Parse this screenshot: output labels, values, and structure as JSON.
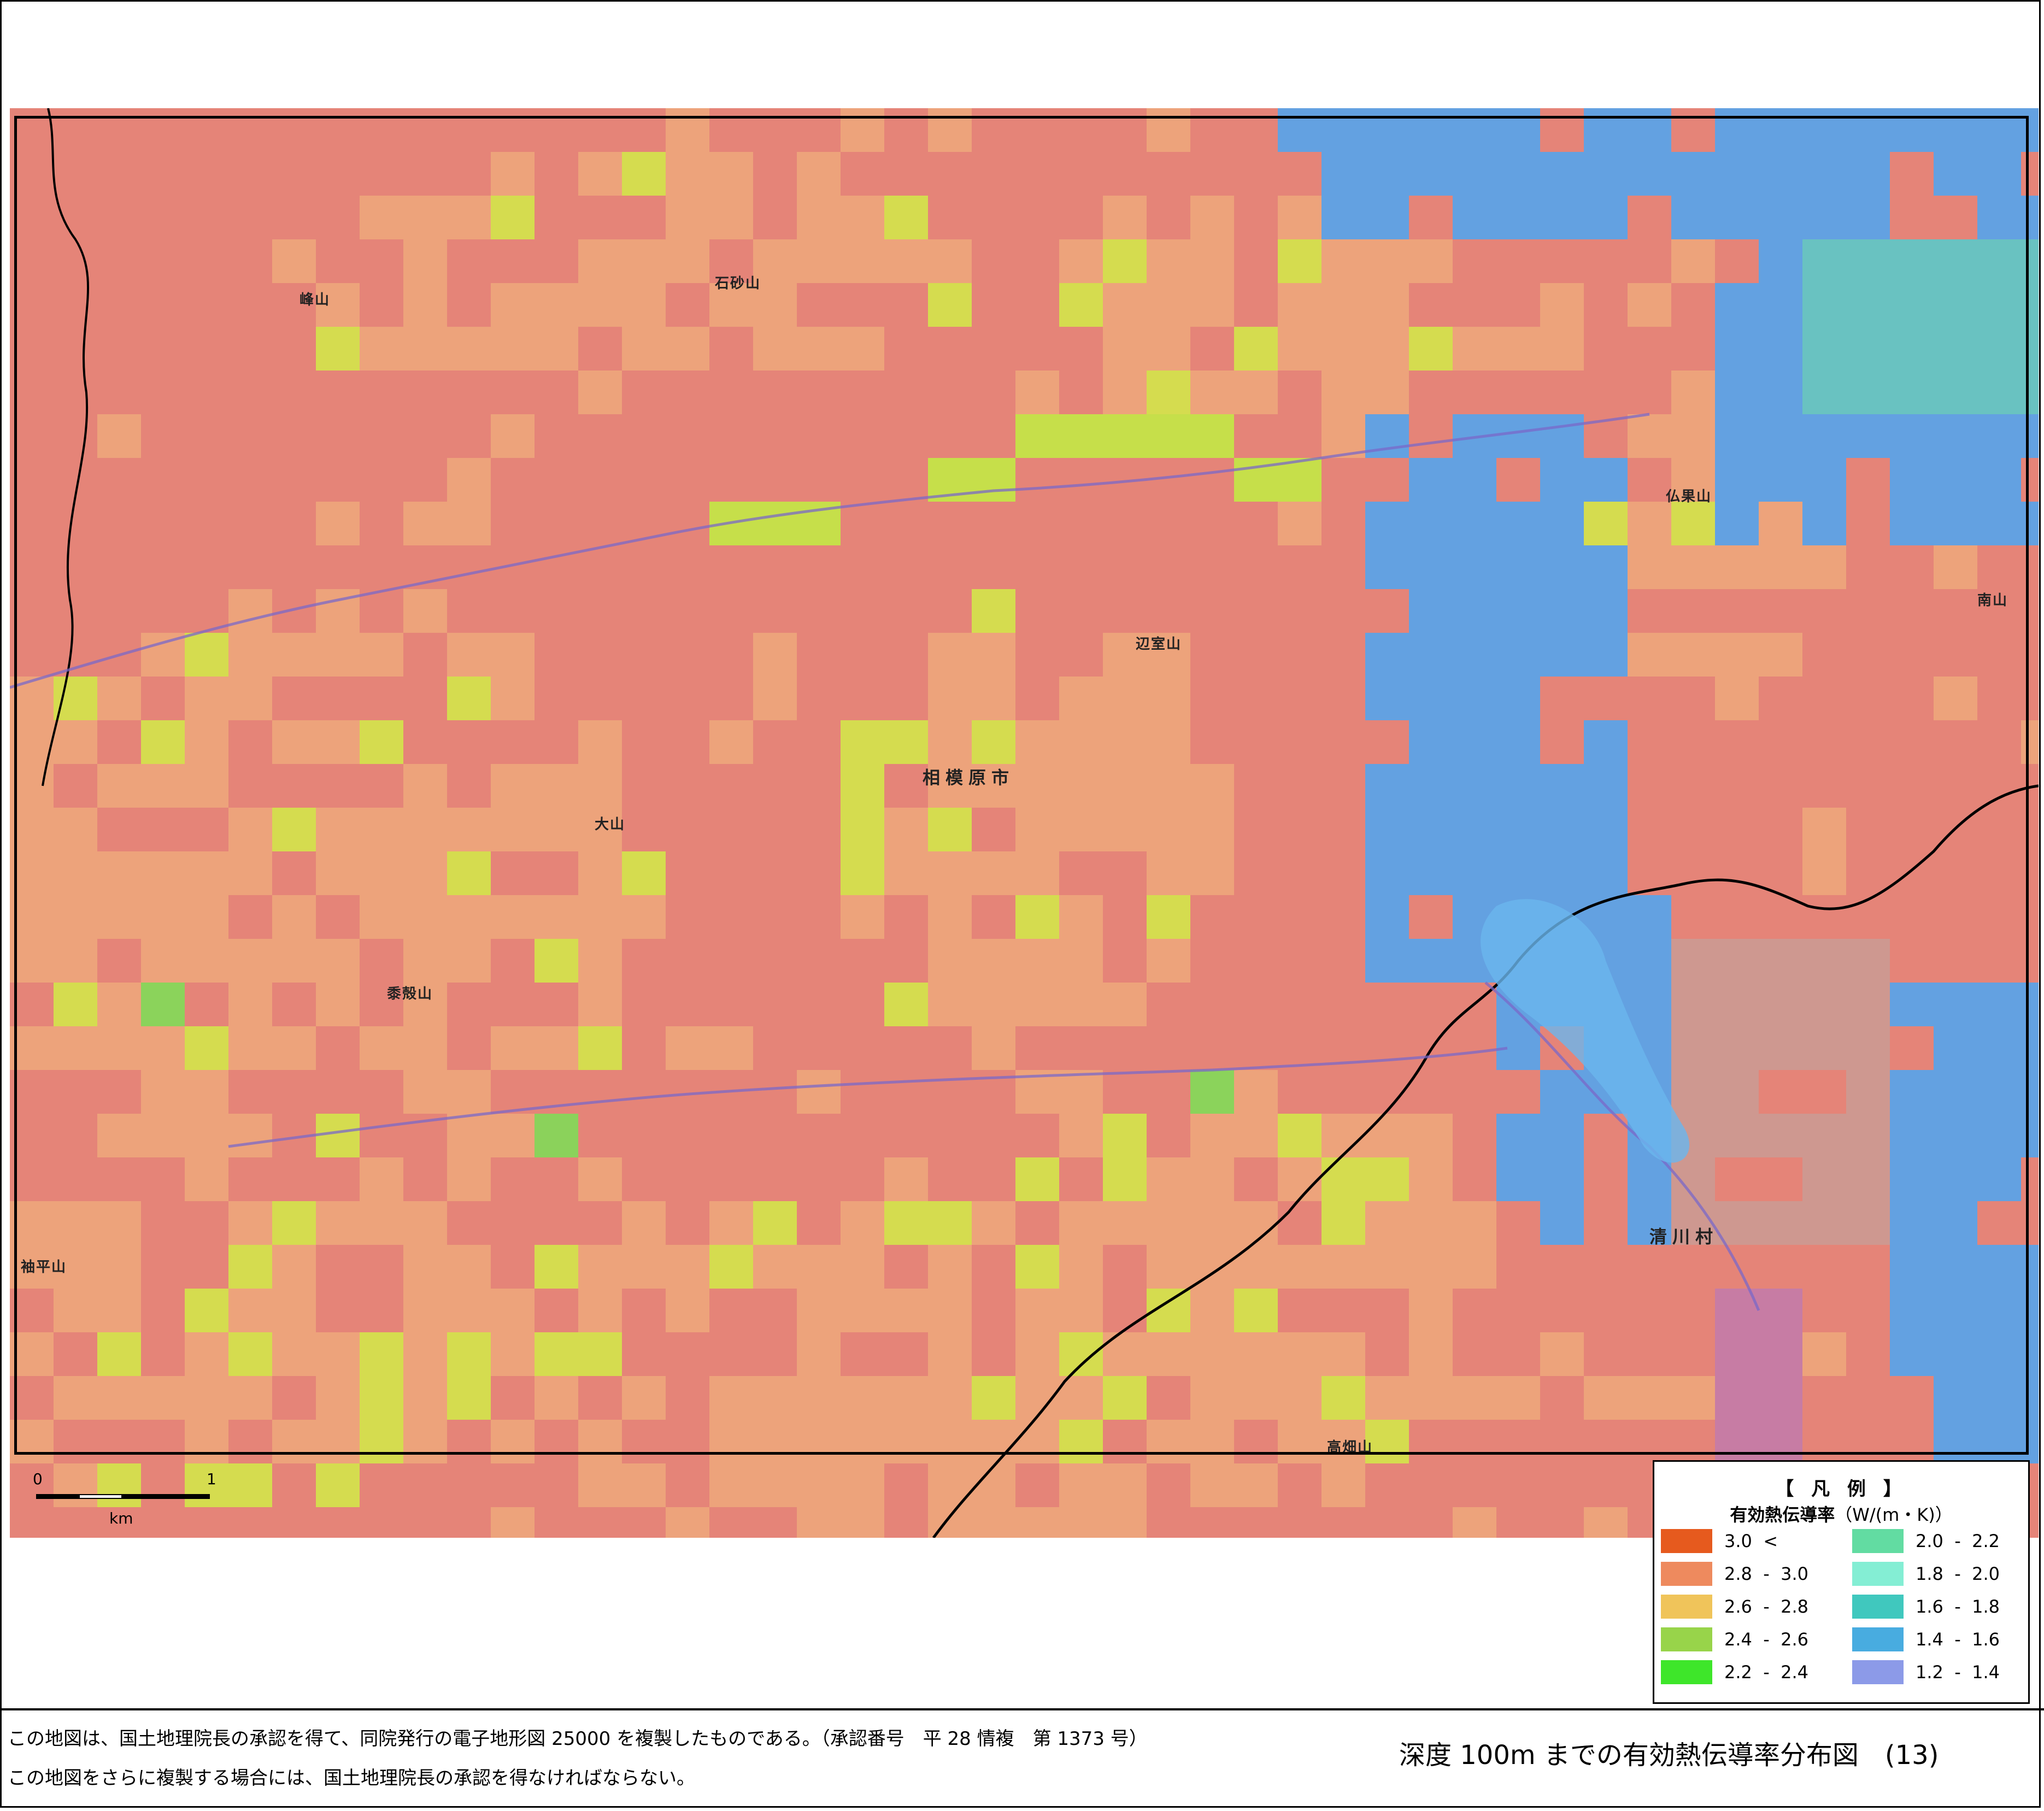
{
  "map": {
    "place_labels": [
      {
        "text": "相模原市",
        "size": "big"
      },
      {
        "text": "清川村",
        "size": "big"
      },
      {
        "text": "石砂山"
      },
      {
        "text": "峰山"
      },
      {
        "text": "仏果山"
      },
      {
        "text": "大山"
      },
      {
        "text": "袖平山"
      },
      {
        "text": "高畑山"
      },
      {
        "text": "南山"
      },
      {
        "text": "黍殻山"
      },
      {
        "text": "辺室山"
      }
    ]
  },
  "scale_bar": {
    "start_label": "0",
    "end_label": "1",
    "unit": "km"
  },
  "legend": {
    "title": "【 凡 例 】",
    "subtitle": "有効熱伝導率",
    "unit": "（W/(m・K)）",
    "items": [
      {
        "label": "3.0  <",
        "color": "#e65a1e"
      },
      {
        "label": "2.8  -  3.0",
        "color": "#ee8a5e"
      },
      {
        "label": "2.6  -  2.8",
        "color": "#f0c45a"
      },
      {
        "label": "2.4  -  2.6",
        "color": "#98d44a"
      },
      {
        "label": "2.2  -  2.4",
        "color": "#3ee62a"
      },
      {
        "label": "2.0  -  2.2",
        "color": "#62dca2"
      },
      {
        "label": "1.8  -  2.0",
        "color": "#84eed4"
      },
      {
        "label": "1.6  -  1.8",
        "color": "#40c8be"
      },
      {
        "label": "1.4  -  1.6",
        "color": "#48ace0"
      },
      {
        "label": "1.2  -  1.4",
        "color": "#8c9ae8"
      }
    ]
  },
  "map_cell_colors": {
    "base": "#e58478",
    "orange": "#eea67c",
    "yellow": "#d4e44c",
    "yellow_green": "#c4e448",
    "green": "#86d65a",
    "blue": "#58a4ea",
    "teal": "#5ec8c8",
    "pinkbrown": "#cc9a92",
    "purple": "#c47ca8"
  },
  "footer": {
    "note_line1": "この地図は、国土地理院長の承認を得て、同院発行の電子地形図 25000 を複製したものである。（承認番号　平 28 情複　第 1373 号）",
    "note_line2": "この地図をさらに複製する場合には、国土地理院長の承認を得なければならない。",
    "title": "深度 100m までの有効熱伝導率分布図　(13)"
  }
}
